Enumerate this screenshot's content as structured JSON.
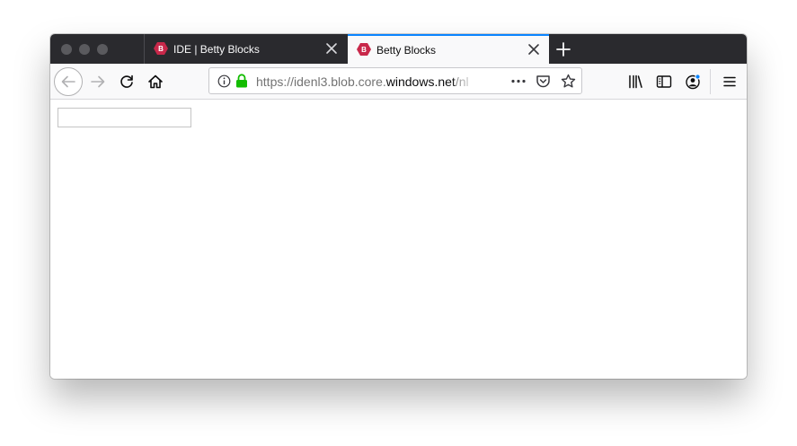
{
  "window": {
    "traffic_lights": [
      "close",
      "minimize",
      "zoom"
    ]
  },
  "tabs": [
    {
      "title": "IDE | Betty Blocks",
      "favicon": "betty-blocks-logo-icon",
      "active": false
    },
    {
      "title": "Betty Blocks",
      "favicon": "betty-blocks-logo-icon",
      "active": true
    }
  ],
  "navbar": {
    "url_prefix": "https://idenl3.blob.core.",
    "url_host": "windows.net",
    "url_suffix": "/nl",
    "icons": [
      "back-icon",
      "forward-icon",
      "reload-icon",
      "home-icon",
      "info-icon",
      "lock-icon",
      "more-icon",
      "pocket-icon",
      "bookmark-star-icon",
      "library-icon",
      "sidebar-icon",
      "account-icon",
      "menu-icon"
    ]
  },
  "page": {
    "input_value": ""
  },
  "colors": {
    "tabbar_bg": "#2a2a2e",
    "active_tab_accent": "#0a84ff",
    "brand": "#c8284a",
    "lock": "#12bc00",
    "account_dot": "#0a84ff"
  }
}
